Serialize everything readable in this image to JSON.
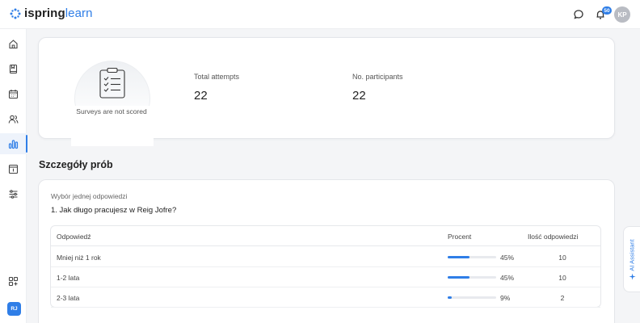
{
  "header": {
    "logo_part1": "ispring",
    "logo_part2": "learn",
    "notification_count": "50",
    "user_initials": "KP"
  },
  "sidebar": {
    "items": [
      {
        "icon": "home-icon"
      },
      {
        "icon": "book-icon"
      },
      {
        "icon": "calendar-icon"
      },
      {
        "icon": "users-icon"
      },
      {
        "icon": "reports-icon",
        "active": true
      },
      {
        "icon": "info-card-icon"
      },
      {
        "icon": "settings-sliders-icon"
      }
    ],
    "bottom_icon": "add-apps-icon",
    "user_initials": "RJ"
  },
  "summary": {
    "not_scored_label": "Surveys are not scored",
    "total_attempts_label": "Total attempts",
    "total_attempts_value": "22",
    "participants_label": "No. participants",
    "participants_value": "22"
  },
  "details": {
    "section_title": "Szczegóły prób",
    "question_type": "Wybór jednej odpowiedzi",
    "question_text": "1. Jak długo pracujesz w Reig Jofre?",
    "columns": {
      "answer": "Odpowiedź",
      "percent": "Procent",
      "count": "Ilość odpowiedzi"
    },
    "rows": [
      {
        "answer": "Mniej niż 1 rok",
        "percent": "45%",
        "percent_value": 45,
        "count": "10"
      },
      {
        "answer": "1-2 lata",
        "percent": "45%",
        "percent_value": 45,
        "count": "10"
      },
      {
        "answer": "2-3 lata",
        "percent": "9%",
        "percent_value": 9,
        "count": "2"
      }
    ]
  },
  "ai_assistant": {
    "label": "AI Assistant"
  },
  "colors": {
    "accent": "#2f7ee7",
    "background": "#f4f5f7"
  }
}
